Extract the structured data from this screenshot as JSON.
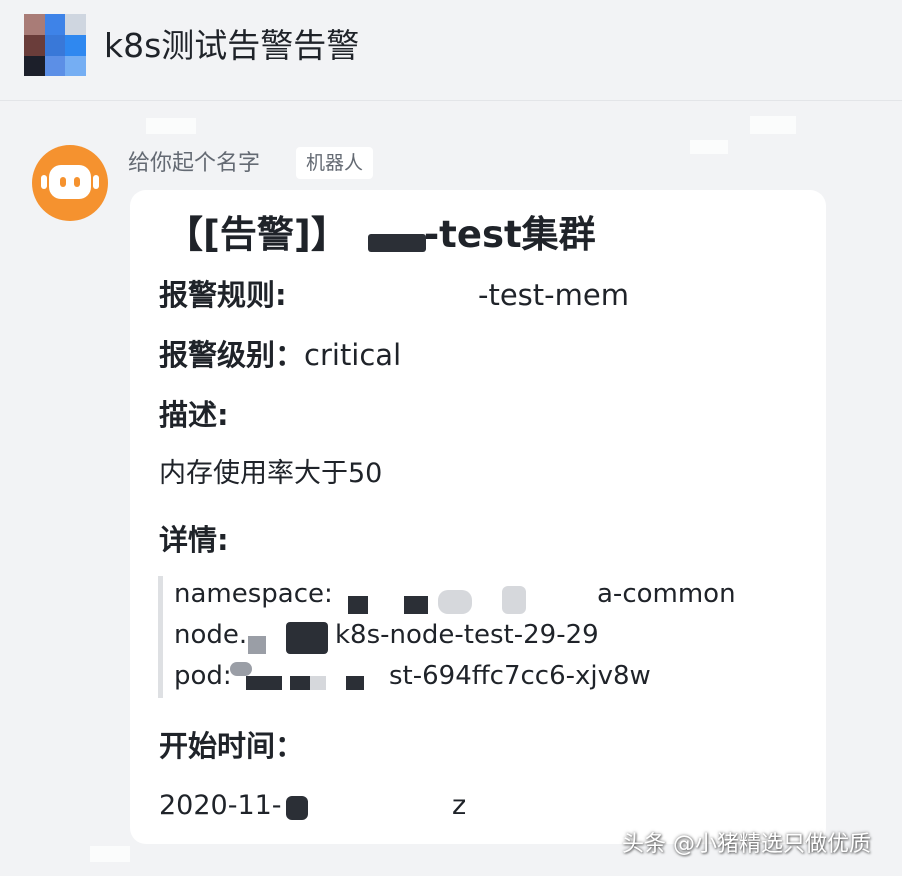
{
  "header": {
    "title": "k8s测试告警告警"
  },
  "message": {
    "sender_name": "给你起个名字",
    "sender_badge": "机器人",
    "card": {
      "title": "【[告警]】",
      "title_suffix": "-test集群",
      "rule_label": "报警规则:",
      "rule_value": "-test-mem",
      "level_label": "报警级别：",
      "level_value": "critical",
      "description_label": "描述:",
      "description_value": "内存使用率大于50",
      "details_label": "详情:",
      "details": {
        "namespace_prefix": "namespace:",
        "namespace_suffix": "a-common",
        "node_prefix": "node.",
        "node_suffix": "k8s-node-test-29-29",
        "pod_prefix": "pod:",
        "pod_suffix": "st-694ffc7cc6-xjv8w"
      },
      "start_time_label": "开始时间：",
      "start_time_value": "2020-11-",
      "start_time_tail": "z"
    }
  },
  "watermark": "头条 @小猪精选只做优质",
  "colors": {
    "background": "#f2f3f5",
    "card": "#ffffff",
    "bot_avatar": "#f5922f",
    "text": "#1f2329",
    "secondary_text": "#646a73"
  },
  "icons": {
    "group_avatar": "group-avatar-icon",
    "bot_avatar": "robot-icon"
  }
}
